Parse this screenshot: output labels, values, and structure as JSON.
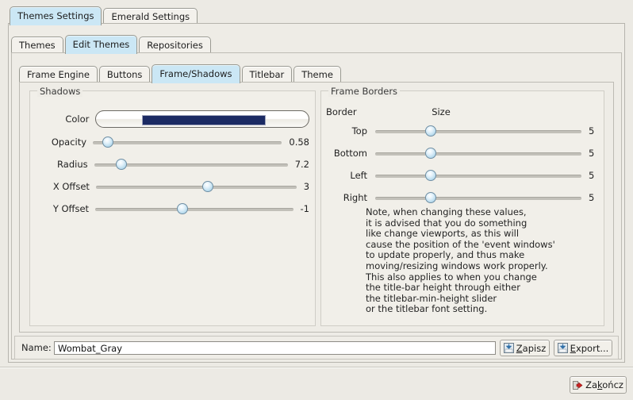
{
  "window": {
    "background": "#eceae4"
  },
  "top_tabs": [
    {
      "label": "Themes Settings",
      "active": true
    },
    {
      "label": "Emerald Settings",
      "active": false
    }
  ],
  "sub_tabs": [
    {
      "label": "Themes",
      "active": false
    },
    {
      "label": "Edit Themes",
      "active": true
    },
    {
      "label": "Repositories",
      "active": false
    }
  ],
  "inner_tabs": [
    {
      "label": "Frame Engine",
      "active": false
    },
    {
      "label": "Buttons",
      "active": false
    },
    {
      "label": "Frame/Shadows",
      "active": true
    },
    {
      "label": "Titlebar",
      "active": false
    },
    {
      "label": "Theme",
      "active": false
    }
  ],
  "shadows": {
    "title": "Shadows",
    "color_row": {
      "label": "Color",
      "swatch_color": "#1b2a63"
    },
    "sliders": [
      {
        "label": "Opacity",
        "value": "0.58",
        "pos_pct": 8
      },
      {
        "label": "Radius",
        "value": "7.2",
        "pos_pct": 14
      },
      {
        "label": "X Offset",
        "value": "3",
        "pos_pct": 56
      },
      {
        "label": "Y Offset",
        "value": "-1",
        "pos_pct": 44
      }
    ]
  },
  "frame_borders": {
    "title": "Frame Borders",
    "col_border": "Border",
    "col_size": "Size",
    "sliders": [
      {
        "label": "Top",
        "value": "5",
        "pos_pct": 27
      },
      {
        "label": "Bottom",
        "value": "5",
        "pos_pct": 27
      },
      {
        "label": "Left",
        "value": "5",
        "pos_pct": 27
      },
      {
        "label": "Right",
        "value": "5",
        "pos_pct": 27
      }
    ],
    "note": "Note, when changing these values,\nit is advised that you do something\nlike change viewports, as this will\ncause the position of the 'event windows'\nto update properly, and thus make\nmoving/resizing windows work properly.\nThis also applies to when you change\nthe title-bar height through either\nthe titlebar-min-height slider\nor the titlebar font setting."
  },
  "bottom": {
    "name_label": "Name:",
    "name_value": "Wombat_Gray",
    "name_placeholder": "",
    "save_button": {
      "label_pre": "",
      "label_accel": "Z",
      "label_post": "apisz"
    },
    "export_button": {
      "label_pre": "",
      "label_accel": "E",
      "label_post": "xport..."
    }
  },
  "footer": {
    "quit_button": {
      "label_pre": "Za",
      "label_accel": "k",
      "label_post": "ończ"
    }
  }
}
